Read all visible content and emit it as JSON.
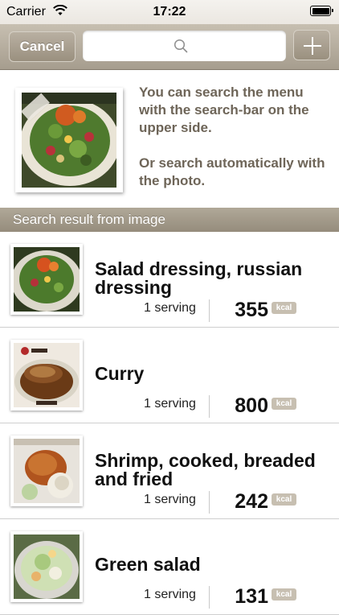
{
  "status_bar": {
    "carrier": "Carrier",
    "time": "17:22"
  },
  "nav": {
    "cancel_label": "Cancel",
    "search_placeholder": "",
    "add_icon": "plus-icon"
  },
  "intro": {
    "line1": "You can search the menu with the search-bar on the upper side.",
    "line2": "Or search automatically with the photo."
  },
  "section_header": "Search result from image",
  "results": [
    {
      "name": "Salad dressing, russian dressing",
      "serving": "1 serving",
      "calories": "355",
      "unit": "kcal"
    },
    {
      "name": "Curry",
      "serving": "1 serving",
      "calories": "800",
      "unit": "kcal"
    },
    {
      "name": "Shrimp, cooked, breaded and fried",
      "serving": "1 serving",
      "calories": "242",
      "unit": "kcal"
    },
    {
      "name": "Green salad",
      "serving": "1 serving",
      "calories": "131",
      "unit": "kcal"
    }
  ],
  "colors": {
    "nav_bar": "#b3aa9b",
    "intro_text": "#6e6558",
    "section_header": "#a39b8b",
    "kcal_badge": "#c7bfb1"
  }
}
